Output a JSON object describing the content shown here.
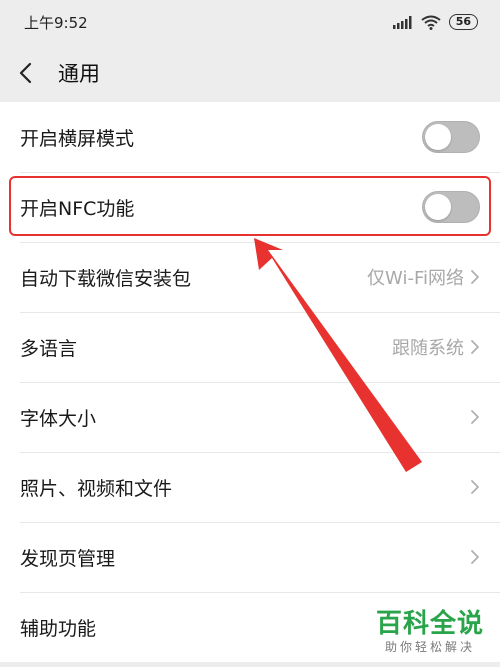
{
  "status_bar": {
    "time": "上午9:52",
    "battery": "56",
    "signal_icon": "signal-icon",
    "wifi_icon": "wifi-icon"
  },
  "nav": {
    "title": "通用",
    "back_icon": "chevron-left-icon"
  },
  "rows": [
    {
      "label": "开启横屏模式",
      "type": "toggle",
      "on": false
    },
    {
      "label": "开启NFC功能",
      "type": "toggle",
      "on": false
    },
    {
      "label": "自动下载微信安装包",
      "type": "link",
      "value": "仅Wi-Fi网络"
    },
    {
      "label": "多语言",
      "type": "link",
      "value": "跟随系统"
    },
    {
      "label": "字体大小",
      "type": "link",
      "value": ""
    },
    {
      "label": "照片、视频和文件",
      "type": "link",
      "value": ""
    },
    {
      "label": "发现页管理",
      "type": "link",
      "value": ""
    },
    {
      "label": "辅助功能",
      "type": "link",
      "value": ""
    }
  ],
  "annotation": {
    "highlight_color": "#e8322f"
  },
  "watermark": {
    "title": "百科全说",
    "subtitle": "助你轻松解决"
  },
  "colors": {
    "page_bg": "#ededed",
    "toggle_off": "#bdbdbd",
    "value_text": "#a8a8a8"
  }
}
